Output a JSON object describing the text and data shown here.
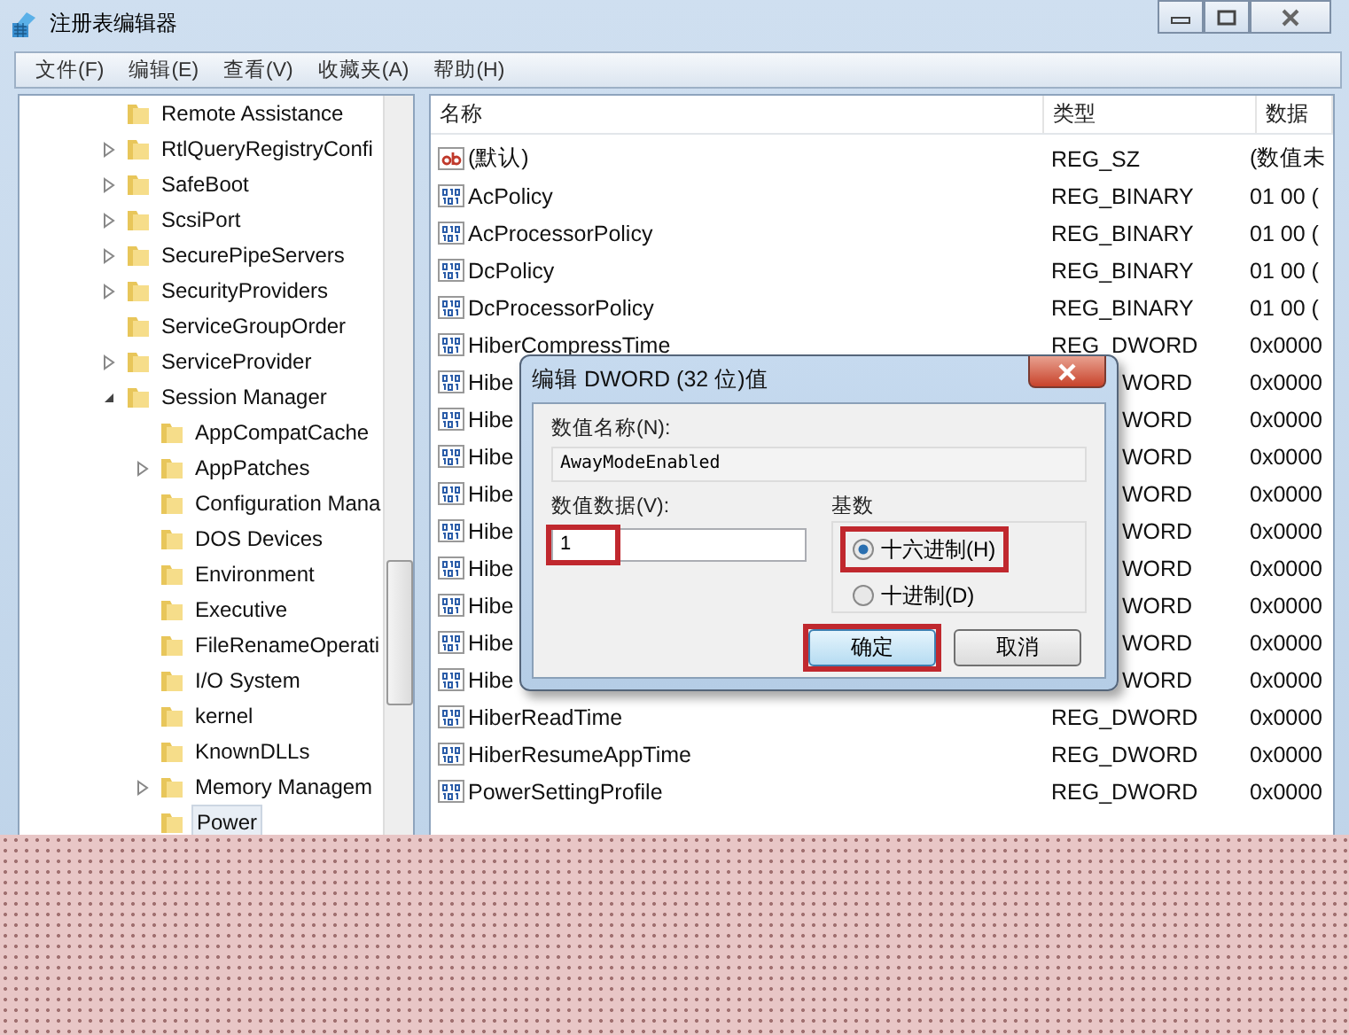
{
  "window": {
    "title": "注册表编辑器"
  },
  "menu": [
    "文件(F)",
    "编辑(E)",
    "查看(V)",
    "收藏夹(A)",
    "帮助(H)"
  ],
  "tree": {
    "items": [
      {
        "label": "Remote Assistance",
        "selected": false
      },
      {
        "label": "RtlQueryRegistryConfi",
        "expanded": false,
        "selected": false
      },
      {
        "label": "SafeBoot",
        "expanded": false,
        "selected": false
      },
      {
        "label": "ScsiPort",
        "expanded": false,
        "selected": false
      },
      {
        "label": "SecurePipeServers",
        "expanded": false,
        "selected": false
      },
      {
        "label": "SecurityProviders",
        "expanded": false,
        "selected": false
      },
      {
        "label": "ServiceGroupOrder",
        "selected": false
      },
      {
        "label": "ServiceProvider",
        "expanded": false,
        "selected": false
      },
      {
        "label": "Session Manager",
        "expanded": true,
        "selected": false,
        "children": [
          {
            "label": "AppCompatCache",
            "selected": false
          },
          {
            "label": "AppPatches",
            "expanded": false,
            "selected": false
          },
          {
            "label": "Configuration Mana",
            "selected": false
          },
          {
            "label": "DOS Devices",
            "selected": false
          },
          {
            "label": "Environment",
            "selected": false
          },
          {
            "label": "Executive",
            "selected": false
          },
          {
            "label": "FileRenameOperati",
            "selected": false
          },
          {
            "label": "I/O System",
            "selected": false
          },
          {
            "label": "kernel",
            "selected": false
          },
          {
            "label": "KnownDLLs",
            "selected": false
          },
          {
            "label": "Memory Managem",
            "expanded": false,
            "selected": false
          },
          {
            "label": "Power",
            "selected": true
          }
        ]
      }
    ]
  },
  "list": {
    "columns": [
      "名称",
      "类型",
      "数据"
    ],
    "rows": [
      {
        "kind": "string",
        "name": "(默认)",
        "type": "REG_SZ",
        "data": "(数值未"
      },
      {
        "kind": "binary",
        "name": "AcPolicy",
        "type": "REG_BINARY",
        "data": "01 00 ("
      },
      {
        "kind": "binary",
        "name": "AcProcessorPolicy",
        "type": "REG_BINARY",
        "data": "01 00 ("
      },
      {
        "kind": "binary",
        "name": "DcPolicy",
        "type": "REG_BINARY",
        "data": "01 00 ("
      },
      {
        "kind": "binary",
        "name": "DcProcessorPolicy",
        "type": "REG_BINARY",
        "data": "01 00 ("
      },
      {
        "kind": "binary",
        "name": "HiberCompressTime",
        "type": "REG_DWORD",
        "data": "0x0000"
      },
      {
        "kind": "binary",
        "name": "Hibe",
        "type": "WORD",
        "data": "0x0000",
        "partial": true
      },
      {
        "kind": "binary",
        "name": "Hibe",
        "type": "WORD",
        "data": "0x0000",
        "partial": true
      },
      {
        "kind": "binary",
        "name": "Hibe",
        "type": "WORD",
        "data": "0x0000",
        "partial": true
      },
      {
        "kind": "binary",
        "name": "Hibe",
        "type": "WORD",
        "data": "0x0000",
        "partial": true
      },
      {
        "kind": "binary",
        "name": "Hibe",
        "type": "WORD",
        "data": "0x0000",
        "partial": true
      },
      {
        "kind": "binary",
        "name": "Hibe",
        "type": "WORD",
        "data": "0x0000",
        "partial": true
      },
      {
        "kind": "binary",
        "name": "Hibe",
        "type": "WORD",
        "data": "0x0000",
        "partial": true
      },
      {
        "kind": "binary",
        "name": "Hibe",
        "type": "WORD",
        "data": "0x0000",
        "partial": true
      },
      {
        "kind": "binary",
        "name": "Hibe",
        "type": "WORD",
        "data": "0x0000",
        "partial": true
      },
      {
        "kind": "binary",
        "name": "HiberReadTime",
        "type": "REG_DWORD",
        "data": "0x0000"
      },
      {
        "kind": "binary",
        "name": "HiberResumeAppTime",
        "type": "REG_DWORD",
        "data": "0x0000"
      },
      {
        "kind": "binary",
        "name": "PowerSettingProfile",
        "type": "REG_DWORD",
        "data": "0x0000"
      }
    ]
  },
  "dialog": {
    "title": "编辑 DWORD (32 位)值",
    "name_label": "数值名称(N):",
    "name_value": "AwayModeEnabled",
    "data_label": "数值数据(V):",
    "data_value": "1",
    "data_highlighted": true,
    "base_label": "基数",
    "radios": [
      {
        "label": "十六进制(H)",
        "selected": true,
        "highlighted": true
      },
      {
        "label": "十进制(D)",
        "selected": false,
        "highlighted": false
      }
    ],
    "buttons": [
      {
        "label": "确定",
        "default": true,
        "highlighted": true
      },
      {
        "label": "取消",
        "default": false,
        "highlighted": false
      }
    ]
  }
}
